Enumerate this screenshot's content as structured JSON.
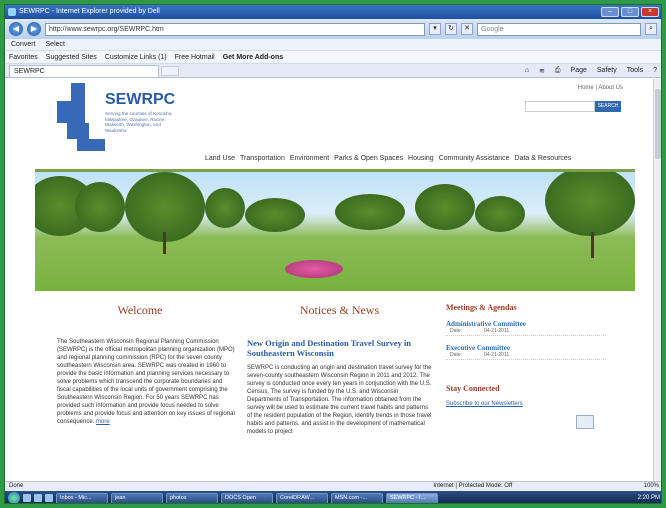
{
  "browser": {
    "title": "SEWRPC - Internet Explorer provided by Dell",
    "url": "http://www.sewrpc.org/SEWRPC.htm",
    "search_placeholder": "Google",
    "cmd": [
      "Convert",
      "Select"
    ],
    "favorites": [
      "Favorites",
      "Suggested Sites",
      "Customize Links (1)",
      "Free Hotmail",
      "Get More Add-ons"
    ],
    "tab_label": "SEWRPC",
    "tools": [
      "Page",
      "Safety",
      "Tools"
    ]
  },
  "site": {
    "logo_name": "SEWRPC",
    "tagline": "Serving the counties of Kenosha, Milwaukee, Ozaukee, Racine, Walworth, Washington, and Waukesha",
    "top_links": [
      "Home",
      "About Us"
    ],
    "search_button": "SEARCH",
    "nav": [
      "Land Use",
      "Transportation",
      "Environment",
      "Parks & Open Spaces",
      "Housing",
      "Community Assistance",
      "Data & Resources"
    ]
  },
  "welcome": {
    "heading": "Welcome",
    "body": "The Southeastern Wisconsin Regional Planning Commission (SEWRPC) is the official metropolitan planning organization (MPO) and regional planning commission (RPC) for the seven county southeastern Wisconsin area. SEWRPC was created in 1960 to provide the basic information and planning services necessary to solve problems which transcend the corporate boundaries and fiscal capabilities of the local units of government comprising the Southeastern Wisconsin Region. For 50 years SEWRPC has provided such information and provide focus needed to solve problems and provide focus and attention on key issues of regional consequence.",
    "more": "more"
  },
  "news": {
    "heading": "Notices & News",
    "title": "New Origin and Destination Travel Survey in Southeastern Wisconsin",
    "body": "SEWRPC is conducting an origin and destination travel survey for the seven-county southeastern Wisconsin Region in 2011 and 2012. The survey is conducted once every ten years in conjunction with the U.S. Census. The survey is funded by the U.S. and Wisconsin Departments of Transportation. The information obtained from the survey will be used to estimate the current travel habits and patterns of the resident population of the Region, identify trends in those travel habits and patterns, and assist in the development of mathematical models to project"
  },
  "meetings": {
    "heading": "Meetings & Agendas",
    "items": [
      {
        "title": "Administrative Committee",
        "date_label": "Date:",
        "date": "04-21-2011"
      },
      {
        "title": "Executive Committee",
        "date_label": "Date:",
        "date": "04-21-2011"
      }
    ],
    "stay_heading": "Stay Connected",
    "subscribe": "Subscribe to our Newsletters"
  },
  "status": {
    "left": "Done",
    "zone": "Internet | Protected Mode: Off",
    "zoom": "100%"
  },
  "taskbar": {
    "tasks": [
      "Inbox - Mic...",
      "jean",
      "photos",
      "DOCS Open",
      "CorelDRAW...",
      "MSN.com -...",
      "SEWRPC - I..."
    ],
    "clock": "2:20 PM"
  }
}
